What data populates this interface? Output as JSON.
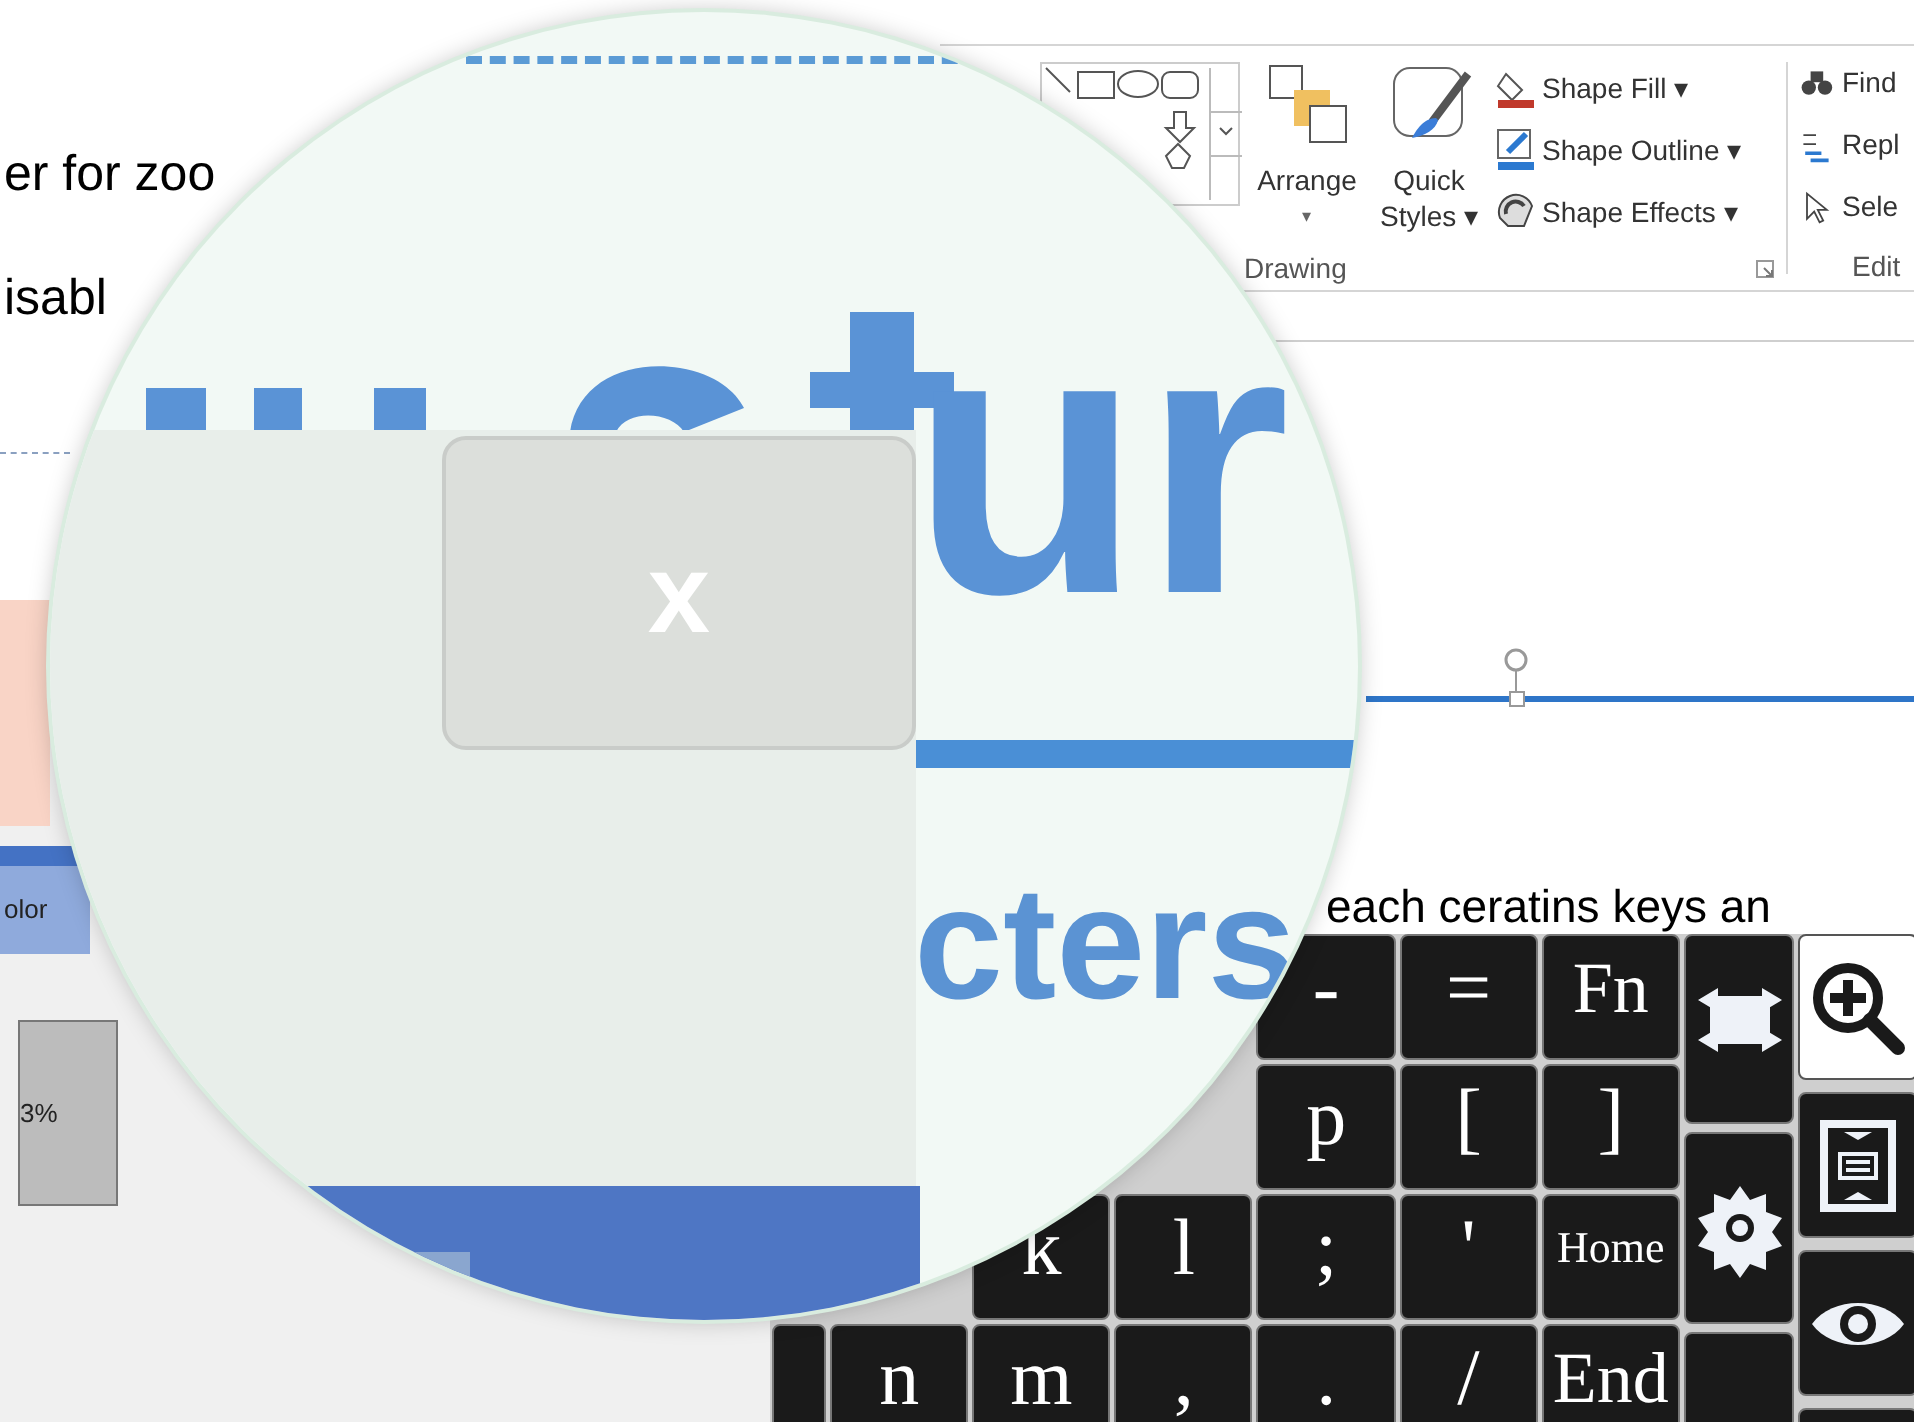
{
  "document_text": [
    "er for zoo",
    "isabl"
  ],
  "side_tab": {
    "label": "olor"
  },
  "percent_box": {
    "value": "3%"
  },
  "ribbon": {
    "drawing_group": {
      "label": "Drawing",
      "large_buttons": [
        {
          "kind": "arrange",
          "lines": [
            "Arrange"
          ],
          "caret": "▾"
        },
        {
          "kind": "quick_styles",
          "lines": [
            "Quick",
            "Styles"
          ],
          "caret": "▾"
        }
      ],
      "small_buttons": [
        {
          "kind": "fill",
          "label": "Shape Fill",
          "caret": "▾"
        },
        {
          "kind": "outline",
          "label": "Shape Outline",
          "caret": "▾"
        },
        {
          "kind": "effects",
          "label": "Shape Effects",
          "caret": "▾"
        }
      ]
    },
    "editing_group": {
      "label": "Edit",
      "items": [
        {
          "kind": "find",
          "label": "Find"
        },
        {
          "kind": "replace",
          "label": "Repl"
        },
        {
          "kind": "select",
          "label": "Sele"
        }
      ]
    }
  },
  "slide": {
    "text": "each ceratins keys an"
  },
  "magnifier": {
    "title_fragment": "ur",
    "close_label": "x",
    "subtitle_fragment": "cters"
  },
  "keyboard": {
    "rows": [
      [
        "",
        "",
        "",
        "-",
        "=",
        "Fn"
      ],
      [
        "",
        "",
        "",
        "p",
        "[",
        "]"
      ],
      [
        "",
        "k",
        "l",
        ";",
        "'",
        "Home"
      ],
      [
        "n",
        "m",
        ",",
        ".",
        "/",
        "End"
      ]
    ],
    "side_keys": [
      {
        "kind": "resize"
      },
      {
        "kind": "settings"
      },
      {
        "kind": "blank"
      }
    ],
    "tool_keys": [
      {
        "kind": "zoom",
        "selected": true
      },
      {
        "kind": "scroll",
        "selected": false
      },
      {
        "kind": "eye",
        "selected": false
      },
      {
        "kind": "blank",
        "selected": false
      }
    ]
  }
}
